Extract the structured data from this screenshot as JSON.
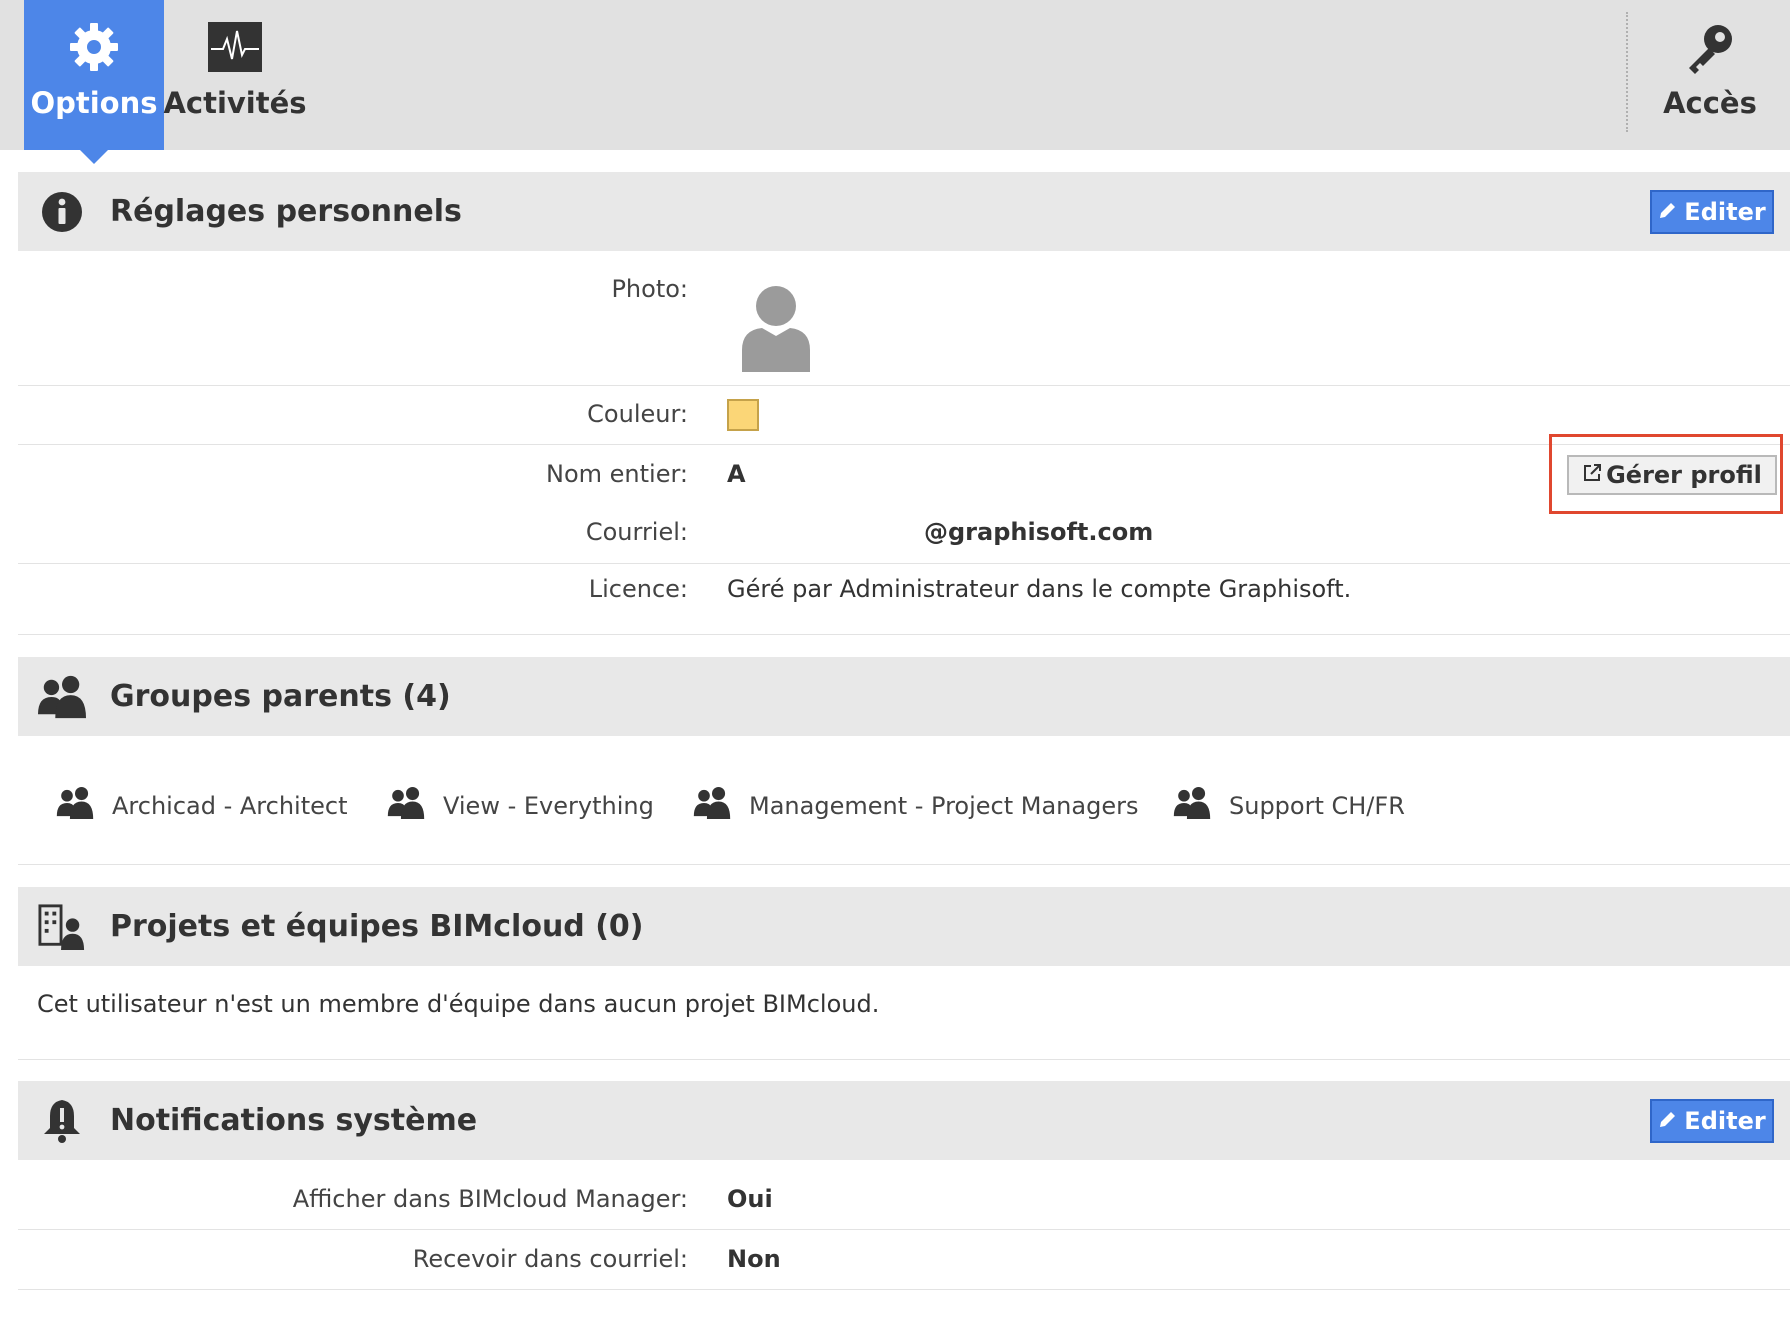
{
  "tabs": {
    "options": "Options",
    "activites": "Activités",
    "acces": "Accès"
  },
  "personal": {
    "title": "Réglages personnels",
    "edit_label": "Editer",
    "photo_label": "Photo:",
    "color_label": "Couleur:",
    "color_value": "#fbd677",
    "fullname_label": "Nom entier:",
    "fullname_value": "A",
    "email_label": "Courriel:",
    "email_value": "@graphisoft.com",
    "license_label": "Licence:",
    "license_value": "Géré par Administrateur dans le compte Graphisoft.",
    "manage_label": "Gérer profil"
  },
  "groups": {
    "title": "Groupes parents (4)",
    "items": [
      "Archicad - Architect",
      "View - Everything",
      "Management - Project Managers",
      "Support CH/FR"
    ]
  },
  "projects": {
    "title": "Projets et équipes BIMcloud (0)",
    "empty_text": "Cet utilisateur n'est un membre d'équipe dans aucun projet BIMcloud."
  },
  "notifications": {
    "title": "Notifications système",
    "edit_label": "Editer",
    "show_label": "Afficher dans BIMcloud Manager:",
    "show_value": "Oui",
    "email_label": "Recevoir dans courriel:",
    "email_value": "Non"
  },
  "colors": {
    "accent": "#4d86e8",
    "highlight": "#e0472f"
  },
  "icons": [
    "gear-icon",
    "pulse-icon",
    "key-icon",
    "info-icon",
    "avatar-icon",
    "pencil-icon",
    "external-link-icon",
    "users-icon",
    "building-user-icon",
    "bell-icon"
  ]
}
